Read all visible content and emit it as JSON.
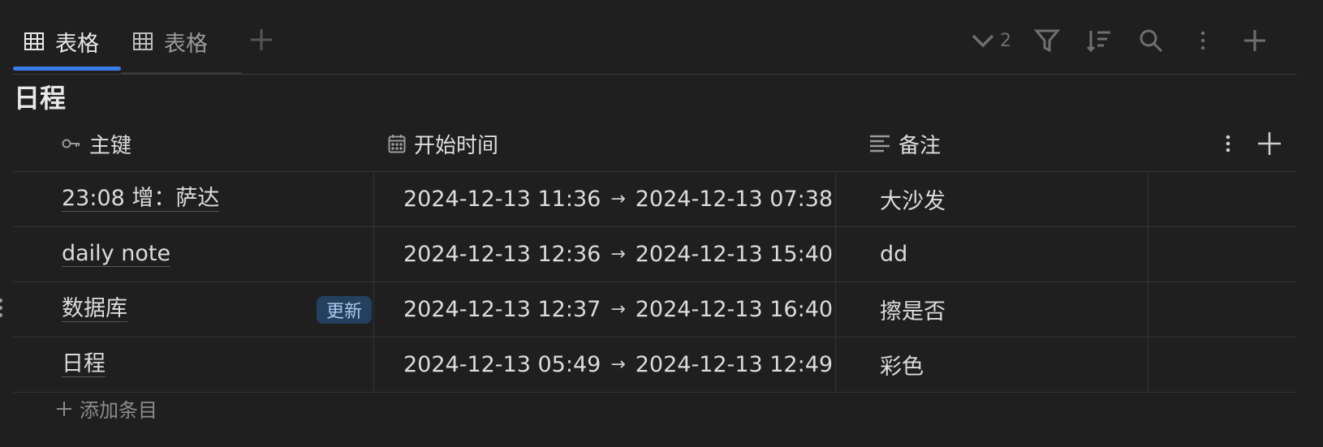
{
  "tabs": [
    {
      "label": "表格",
      "icon": "table-icon",
      "active": true
    },
    {
      "label": "表格",
      "icon": "table-icon",
      "active": false
    }
  ],
  "toolbar": {
    "collapse_count": "2",
    "icons": [
      "chevron-down-icon",
      "filter-icon",
      "sort-icon",
      "search-icon",
      "more-vertical-icon",
      "plus-icon"
    ]
  },
  "page_title": "日程",
  "columns": [
    {
      "label": "主键",
      "icon": "key-icon"
    },
    {
      "label": "开始时间",
      "icon": "calendar-icon"
    },
    {
      "label": "备注",
      "icon": "text-align-icon"
    }
  ],
  "rows": [
    {
      "key": "23:08 增：萨达",
      "start": "2024-12-13 11:36",
      "end": "2024-12-13 07:38",
      "note": "大沙发",
      "badge": ""
    },
    {
      "key": "daily note",
      "start": "2024-12-13 12:36",
      "end": "2024-12-13 15:40",
      "note": "dd",
      "badge": ""
    },
    {
      "key": "数据库",
      "start": "2024-12-13 12:37",
      "end": "2024-12-13 16:40",
      "note": "擦是否",
      "badge": "更新"
    },
    {
      "key": "日程",
      "start": "2024-12-13 05:49",
      "end": "2024-12-13 12:49",
      "note": "彩色",
      "badge": ""
    }
  ],
  "arrow": "→",
  "add_entry_label": "添加条目",
  "colors": {
    "accent": "#3b7ced",
    "background": "#1f1f1f",
    "badge_bg": "#24405f"
  }
}
